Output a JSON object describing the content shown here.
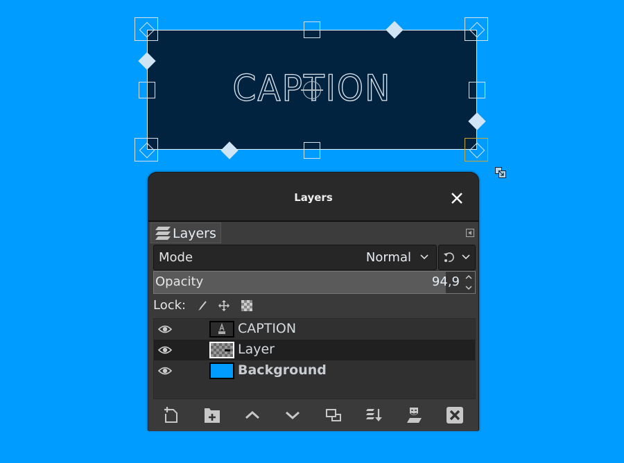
{
  "canvas": {
    "text_layer_content": "CAPTION",
    "background_color": "#009cff",
    "text_layer_fill": "#012340"
  },
  "dialog": {
    "title": "Layers",
    "close_icon": "close-icon",
    "tab": {
      "label": "Layers",
      "icon": "layers-stack-icon"
    },
    "tab_menu_icon": "tab-menu-icon",
    "mode": {
      "label": "Mode",
      "value": "Normal"
    },
    "composite_icon": "composite-mode-icon",
    "opacity": {
      "label": "Opacity",
      "value": "94,9",
      "percent": 94.9
    },
    "lock": {
      "label": "Lock:",
      "icons": [
        "lock-pixels-icon",
        "lock-position-icon",
        "lock-alpha-icon"
      ]
    },
    "layers": [
      {
        "name": "CAPTION",
        "type": "text",
        "visible": true,
        "selected": false,
        "bold": false
      },
      {
        "name": "Layer",
        "type": "transparent",
        "visible": true,
        "selected": true,
        "bold": false
      },
      {
        "name": "Background",
        "type": "color",
        "visible": true,
        "selected": false,
        "bold": true,
        "color": "#009cff"
      }
    ],
    "bottom_tools": [
      {
        "name": "new-layer",
        "icon": "new-layer-icon"
      },
      {
        "name": "new-layer-group",
        "icon": "new-group-icon"
      },
      {
        "name": "raise-layer",
        "icon": "chevron-up-icon"
      },
      {
        "name": "lower-layer",
        "icon": "chevron-down-icon"
      },
      {
        "name": "duplicate-layer",
        "icon": "duplicate-icon"
      },
      {
        "name": "merge-down",
        "icon": "merge-down-icon"
      },
      {
        "name": "add-mask",
        "icon": "mask-icon"
      },
      {
        "name": "delete-layer",
        "icon": "delete-icon"
      }
    ]
  }
}
